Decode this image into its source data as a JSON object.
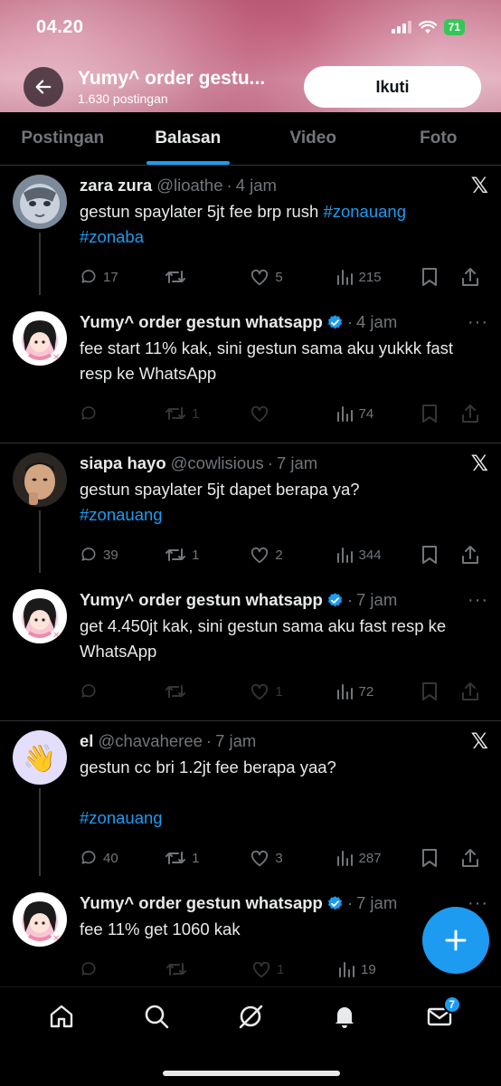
{
  "status_bar": {
    "time": "04.20",
    "battery": "71"
  },
  "header": {
    "title": "Yumy^ order gestu...",
    "subtitle": "1.630 postingan",
    "follow_label": "Ikuti"
  },
  "tabs": [
    {
      "label": "Postingan",
      "active": false
    },
    {
      "label": "Balasan",
      "active": true
    },
    {
      "label": "Video",
      "active": false
    },
    {
      "label": "Foto",
      "active": false
    }
  ],
  "threads": [
    {
      "original": {
        "name": "zara zura",
        "handle": "@lioathe",
        "age": "4 jam",
        "text_plain": "gestun spaylater 5jt fee brp rush ",
        "hashtags": [
          "#zonauang",
          "#zonaba"
        ],
        "replies": "17",
        "retweets": "",
        "likes": "5",
        "views": "215"
      },
      "reply": {
        "name": "Yumy^ order gestun whatsapp",
        "age": "4 jam",
        "text": "fee start 11% kak, sini gestun sama aku yukkk fast resp ke WhatsApp",
        "replies": "",
        "retweets": "1",
        "likes": "",
        "views": "74"
      }
    },
    {
      "original": {
        "name": "siapa hayo",
        "handle": "@cowlisious",
        "age": "7 jam",
        "text_plain": "gestun spaylater 5jt dapet berapa ya?",
        "hashtags": [
          "#zonauang"
        ],
        "replies": "39",
        "retweets": "1",
        "likes": "2",
        "views": "344"
      },
      "reply": {
        "name": "Yumy^ order gestun whatsapp",
        "age": "7 jam",
        "text": "get 4.450jt kak, sini gestun sama aku fast resp ke WhatsApp",
        "replies": "",
        "retweets": "",
        "likes": "1",
        "views": "72"
      }
    },
    {
      "original": {
        "name": "el",
        "handle": "@chavaheree",
        "age": "7 jam",
        "text_plain": "gestun cc bri 1.2jt fee berapa yaa?",
        "hashtags": [
          "#zonauang"
        ],
        "replies": "40",
        "retweets": "1",
        "likes": "3",
        "views": "287"
      },
      "reply": {
        "name": "Yumy^ order gestun whatsapp",
        "age": "7 jam",
        "text": "fee 11% get 1060 kak",
        "replies": "",
        "retweets": "",
        "likes": "1",
        "views": "19"
      }
    }
  ],
  "bottom_nav": {
    "items": [
      "home-icon",
      "search-icon",
      "grok-icon",
      "notifications-icon",
      "messages-icon"
    ],
    "messages_badge": "7"
  },
  "colors": {
    "accent": "#1d9bf0",
    "background": "#000000",
    "muted": "#71767b",
    "divider": "#2f3336"
  }
}
